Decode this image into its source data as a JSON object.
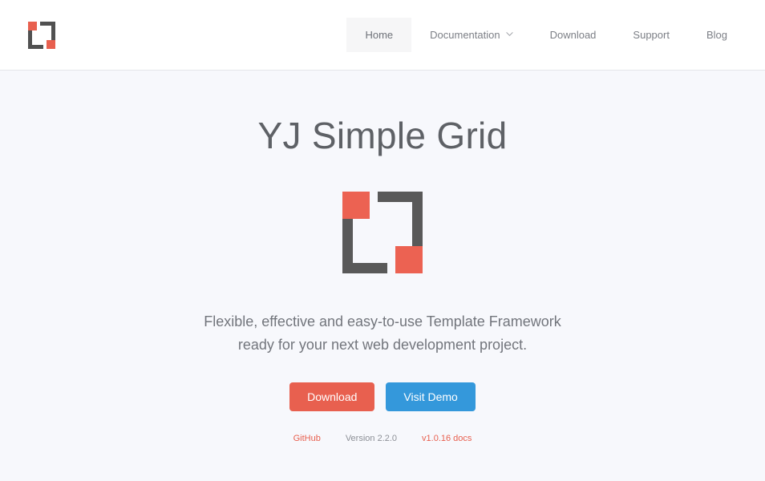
{
  "header": {
    "logo_icon": "yj-grid-logo-icon",
    "nav": [
      {
        "label": "Home",
        "active": true,
        "has_dropdown": false
      },
      {
        "label": "Documentation",
        "active": false,
        "has_dropdown": true
      },
      {
        "label": "Download",
        "active": false,
        "has_dropdown": false
      },
      {
        "label": "Support",
        "active": false,
        "has_dropdown": false
      },
      {
        "label": "Blog",
        "active": false,
        "has_dropdown": false
      }
    ]
  },
  "hero": {
    "title": "YJ Simple Grid",
    "logo_icon": "yj-grid-logo-icon",
    "tagline_line1": "Flexible, effective and easy-to-use Template Framework",
    "tagline_line2": "ready for your next web development project.",
    "buttons": {
      "download": "Download",
      "demo": "Visit Demo"
    },
    "meta": {
      "github": "GitHub",
      "version": "Version 2.2.0",
      "docs": "v1.0.16 docs"
    }
  },
  "colors": {
    "accent_red": "#e8604f",
    "accent_blue": "#3498db",
    "logo_dark": "#595959",
    "page_background": "#f7f8fc",
    "header_background": "#ffffff"
  }
}
